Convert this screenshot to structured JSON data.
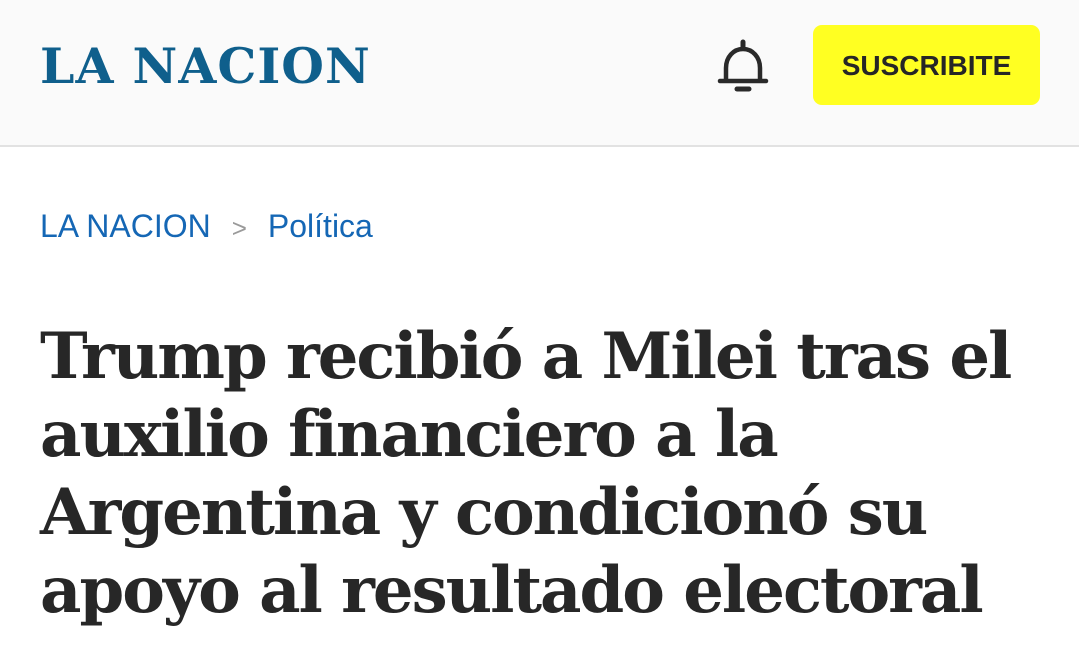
{
  "header": {
    "logo_text": "LA NACION",
    "notification_icon": "bell-icon",
    "subscribe_label": "SUSCRIBITE"
  },
  "breadcrumb": {
    "items": [
      {
        "label": "LA NACION"
      },
      {
        "label": "Política"
      }
    ],
    "separator": ">"
  },
  "article": {
    "headline": "Trump recibió a Milei tras el auxilio financiero a la Argentina y condicionó su apoyo al resultado electoral"
  },
  "colors": {
    "logo": "#0f5f8c",
    "subscribe_bg": "#ffff22",
    "link": "#1567b5",
    "headline": "#272727"
  }
}
